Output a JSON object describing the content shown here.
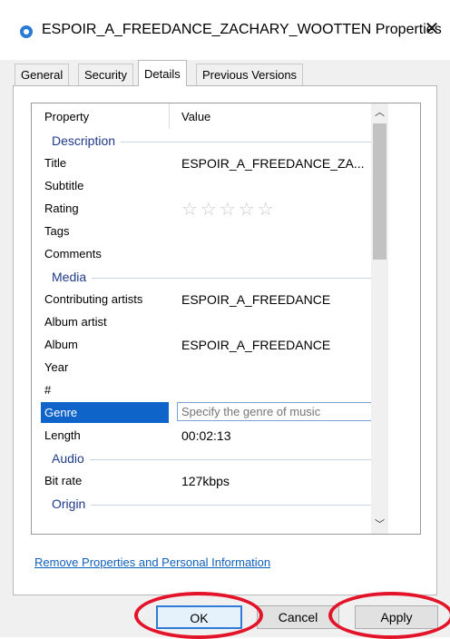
{
  "window": {
    "title": "ESPOIR_A_FREEDANCE_ZACHARY_WOOTTEN Properties",
    "close_glyph": "✕"
  },
  "tabs": [
    {
      "label": "General"
    },
    {
      "label": "Security"
    },
    {
      "label": "Details"
    },
    {
      "label": "Previous Versions"
    }
  ],
  "table": {
    "header": {
      "property": "Property",
      "value": "Value"
    },
    "groups": [
      {
        "label": "Description",
        "rows": [
          {
            "property": "Title",
            "value": "ESPOIR_A_FREEDANCE_ZA..."
          },
          {
            "property": "Subtitle",
            "value": ""
          },
          {
            "property": "Rating",
            "stars": "☆☆☆☆☆"
          },
          {
            "property": "Tags",
            "value": ""
          },
          {
            "property": "Comments",
            "value": ""
          }
        ]
      },
      {
        "label": "Media",
        "rows": [
          {
            "property": "Contributing artists",
            "value": "ESPOIR_A_FREEDANCE"
          },
          {
            "property": "Album artist",
            "value": ""
          },
          {
            "property": "Album",
            "value": "ESPOIR_A_FREEDANCE"
          },
          {
            "property": "Year",
            "value": ""
          },
          {
            "property": "#",
            "value": ""
          },
          {
            "property": "Genre",
            "placeholder": "Specify the genre of music"
          },
          {
            "property": "Length",
            "value": "00:02:13"
          }
        ]
      },
      {
        "label": "Audio",
        "rows": [
          {
            "property": "Bit rate",
            "value": "127kbps"
          }
        ]
      },
      {
        "label": "Origin",
        "rows": []
      }
    ]
  },
  "scrollbar": {
    "up_glyph": "︿",
    "down_glyph": "﹀"
  },
  "link_text": "Remove Properties and Personal Information",
  "buttons": {
    "ok": "OK",
    "cancel": "Cancel",
    "apply": "Apply"
  },
  "colors": {
    "accent": "#0e64c8",
    "annotation": "#e3142a",
    "link": "#0f5fb8",
    "group_label": "#1e3a8a"
  }
}
